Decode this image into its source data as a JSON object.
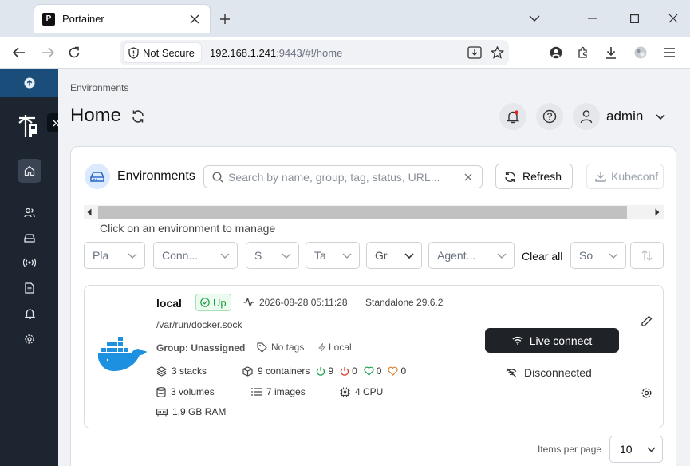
{
  "browser": {
    "tab_title": "Portainer",
    "favicon_text": "P",
    "security_label": "Not Secure",
    "url_host": "192.168.1.241",
    "url_rest": ":9443/#!/home"
  },
  "header": {
    "breadcrumb": "Environments",
    "title": "Home",
    "username": "admin"
  },
  "environments_panel": {
    "title": "Environments",
    "search_placeholder": "Search by name, group, tag, status, URL...",
    "refresh_label": "Refresh",
    "kubeconfig_label": "Kubeconf",
    "hint": "Click on an environment to manage",
    "filters": {
      "platform": "Pla",
      "connection": "Conn...",
      "status": "S",
      "tags": "Ta",
      "groups": "Gr",
      "agent": "Agent...",
      "sort": "So"
    },
    "clear_all": "Clear all"
  },
  "environment": {
    "name": "local",
    "status": "Up",
    "heartbeat": "2026-08-28 05:11:28",
    "type_version": "Standalone 29.6.2",
    "path": "/var/run/docker.sock",
    "group": "Group: Unassigned",
    "tags": "No tags",
    "locality": "Local",
    "stacks": "3 stacks",
    "containers": "9 containers",
    "running": "9",
    "stopped": "0",
    "healthy": "0",
    "unhealthy": "0",
    "volumes": "3 volumes",
    "images": "7 images",
    "cpu": "4 CPU",
    "ram": "1.9 GB RAM",
    "live_connect": "Live connect",
    "connection_state": "Disconnected"
  },
  "pagination": {
    "items_per_page_label": "Items per page",
    "items_per_page": "10"
  },
  "colors": {
    "sidebar": "#1d2530",
    "sidebar_top": "#1b4d7a",
    "docker_blue": "#1d91e0",
    "up_green": "#1f9d3e",
    "stopped_red": "#d9412c",
    "healthy_green": "#22a652",
    "unhealthy_orange": "#d9822b"
  }
}
